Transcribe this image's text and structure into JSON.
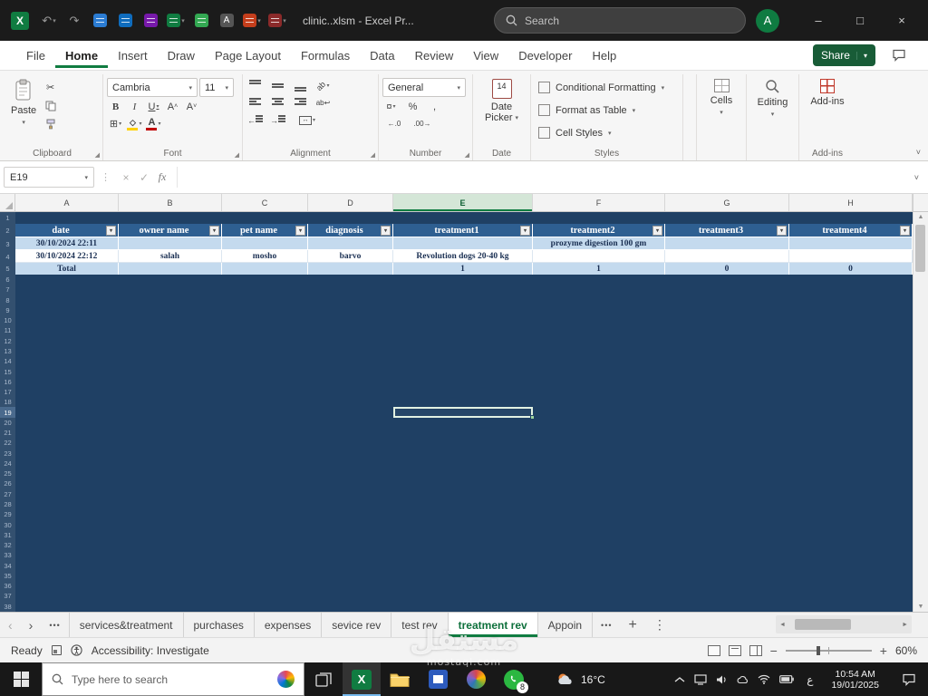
{
  "titlebar": {
    "title": "clinic..xlsm  -  Excel Pr...",
    "search_placeholder": "Search",
    "avatar_initial": "A"
  },
  "ribbon_tabs": [
    {
      "label": "File"
    },
    {
      "label": "Home",
      "active": true
    },
    {
      "label": "Insert"
    },
    {
      "label": "Draw"
    },
    {
      "label": "Page Layout"
    },
    {
      "label": "Formulas"
    },
    {
      "label": "Data"
    },
    {
      "label": "Review"
    },
    {
      "label": "View"
    },
    {
      "label": "Developer"
    },
    {
      "label": "Help"
    }
  ],
  "share_label": "Share",
  "ribbon": {
    "paste_label": "Paste",
    "font_name": "Cambria",
    "font_size": "11",
    "number_format": "General",
    "date_picker_line1": "Date",
    "date_picker_line2": "Picker",
    "date_icon_day": "14",
    "styles_items": [
      {
        "label": "Conditional Formatting"
      },
      {
        "label": "Format as Table"
      },
      {
        "label": "Cell Styles"
      }
    ],
    "cells_label": "Cells",
    "editing_label": "Editing",
    "addins_label": "Add-ins",
    "groups": {
      "clipboard": "Clipboard",
      "font": "Font",
      "alignment": "Alignment",
      "number": "Number",
      "date": "Date",
      "styles": "Styles",
      "addins": "Add-ins"
    }
  },
  "formula_bar": {
    "name_box": "E19",
    "formula": ""
  },
  "sheet": {
    "columns": [
      "A",
      "B",
      "C",
      "D",
      "E",
      "F",
      "G",
      "H"
    ],
    "row_numbers": [
      1,
      2,
      3,
      4,
      5,
      6,
      7,
      8,
      9,
      10,
      11,
      12,
      13,
      14,
      15,
      16,
      17,
      18,
      19,
      20,
      21,
      22,
      23,
      24,
      25,
      26,
      27,
      28,
      29,
      30,
      31,
      32,
      33,
      34,
      35,
      36,
      37,
      38
    ],
    "table_headers": [
      "date",
      "owner name",
      "pet name",
      "diagnosis",
      "treatment1",
      "treatment2",
      "treatment3",
      "treatment4"
    ],
    "row3": [
      "30/10/2024 22:11",
      "",
      "",
      "",
      "",
      "prozyme digestion 100 gm",
      "",
      ""
    ],
    "row4": [
      "30/10/2024 22:12",
      "salah",
      "mosho",
      "barvo",
      "Revolution dogs 20-40 kg",
      "",
      "",
      ""
    ],
    "row5": [
      "Total",
      "",
      "",
      "",
      "1",
      "1",
      "0",
      "0"
    ]
  },
  "sheet_tabs": [
    {
      "label": "services&treatment"
    },
    {
      "label": "purchases"
    },
    {
      "label": "expenses"
    },
    {
      "label": "sevice rev"
    },
    {
      "label": "test rev"
    },
    {
      "label": "treatment rev",
      "active": true
    },
    {
      "label": "Appoin"
    }
  ],
  "status_bar": {
    "mode": "Ready",
    "accessibility": "Accessibility: Investigate",
    "zoom": "60%"
  },
  "taskbar": {
    "search_placeholder": "Type here to search",
    "weather_temp": "16°C",
    "whatsapp_badge": "8",
    "language": "ع",
    "time": "10:54 AM",
    "date": "19/01/2025"
  },
  "watermark": {
    "arabic": "مستقل",
    "latin": "mostaql.com"
  }
}
